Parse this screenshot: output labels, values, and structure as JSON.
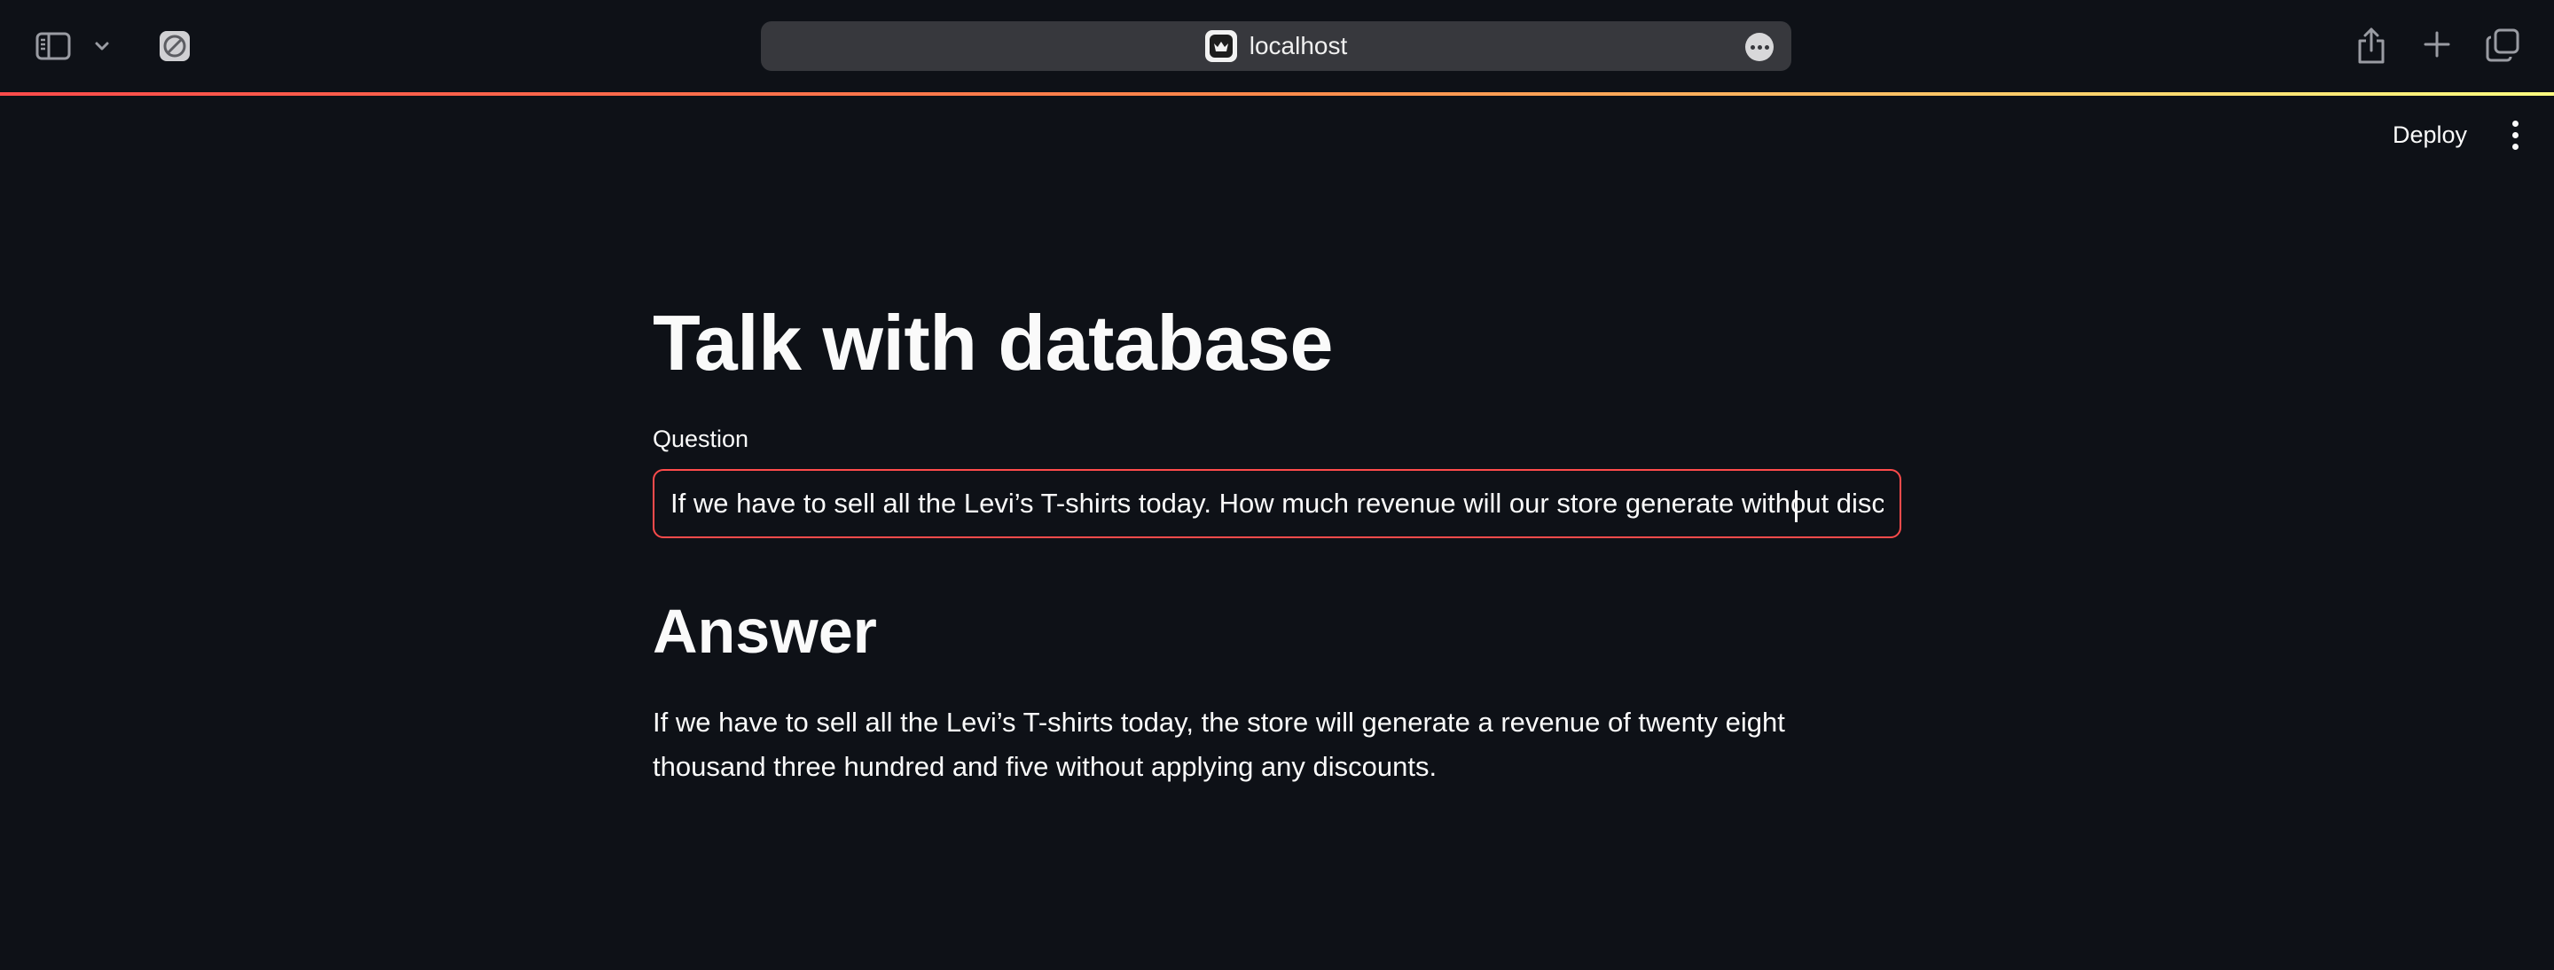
{
  "browser": {
    "url": "localhost",
    "icons": {
      "sidebar_toggle": "sidebar-icon",
      "sidebar_menu": "chevron-down-icon",
      "privacy": "compass-icon",
      "site": "streamlit-crown-icon",
      "page_menu": "more-icon",
      "share": "share-icon",
      "new_tab": "plus-icon",
      "tab_overview": "tabs-icon"
    }
  },
  "app_header": {
    "deploy_label": "Deploy",
    "menu_icon": "kebab-menu-icon"
  },
  "colors": {
    "background": "#0e1117",
    "accent": "#ff4b4b",
    "text": "#fafafa"
  },
  "main": {
    "title": "Talk with database",
    "question_label": "Question",
    "question_value": "If we have to sell all the Levi’s T-shirts today. How much revenue will our store generate without discour",
    "answer_heading": "Answer",
    "answer_text": "If we have to sell all the Levi’s T-shirts today, the store will generate a revenue of twenty eight thousand three hundred and five without applying any discounts."
  }
}
